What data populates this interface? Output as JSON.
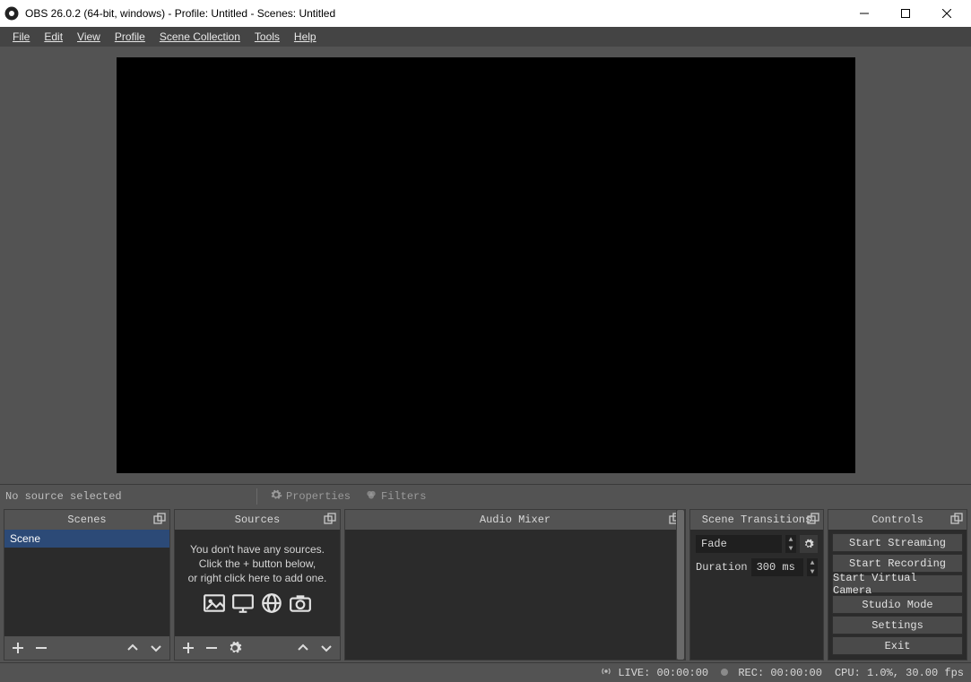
{
  "titlebar": {
    "title": "OBS 26.0.2 (64-bit, windows) - Profile: Untitled - Scenes: Untitled"
  },
  "menu": {
    "file": "File",
    "edit": "Edit",
    "view": "View",
    "profile": "Profile",
    "scene_collection": "Scene Collection",
    "tools": "Tools",
    "help": "Help"
  },
  "source_toolbar": {
    "no_source": "No source selected",
    "properties": "Properties",
    "filters": "Filters"
  },
  "panels": {
    "scenes_title": "Scenes",
    "sources_title": "Sources",
    "mixer_title": "Audio Mixer",
    "transitions_title": "Scene Transitions",
    "controls_title": "Controls"
  },
  "scenes": {
    "items": [
      "Scene"
    ]
  },
  "sources": {
    "empty_line1": "You don't have any sources.",
    "empty_line2": "Click the + button below,",
    "empty_line3": "or right click here to add one."
  },
  "transitions": {
    "current": "Fade",
    "duration_label": "Duration",
    "duration_value": "300 ms"
  },
  "controls": {
    "start_streaming": "Start Streaming",
    "start_recording": "Start Recording",
    "start_virtual_camera": "Start Virtual Camera",
    "studio_mode": "Studio Mode",
    "settings": "Settings",
    "exit": "Exit"
  },
  "status": {
    "live": "LIVE: 00:00:00",
    "rec": "REC: 00:00:00",
    "cpu": "CPU: 1.0%, 30.00 fps"
  }
}
